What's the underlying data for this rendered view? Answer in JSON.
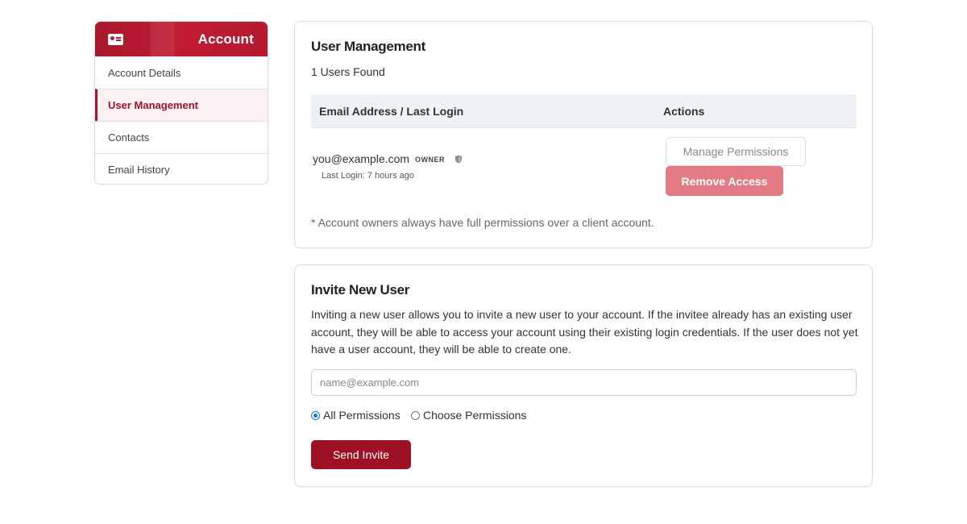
{
  "sidebar": {
    "title": "Account",
    "icon": "id-card-icon",
    "items": [
      {
        "label": "Account Details",
        "active": false
      },
      {
        "label": "User Management",
        "active": true
      },
      {
        "label": "Contacts",
        "active": false
      },
      {
        "label": "Email History",
        "active": false
      }
    ]
  },
  "user_management": {
    "title": "User Management",
    "count_text": "1 Users Found",
    "columns": [
      "Email Address / Last Login",
      "Actions"
    ],
    "rows": [
      {
        "email": "you@example.com",
        "badge": "OWNER",
        "last_login": "Last Login: 7 hours ago",
        "manage_label": "Manage Permissions",
        "remove_label": "Remove Access"
      }
    ],
    "note": "* Account owners always have full permissions over a client account."
  },
  "invite": {
    "title": "Invite New User",
    "description": "Inviting a new user allows you to invite a new user to your account. If the invitee already has an existing user account, they will be able to access your account using their existing login credentials. If the user does not yet have a user account, they will be able to create one.",
    "email_placeholder": "name@example.com",
    "email_value": "",
    "options": [
      {
        "label": "All Permissions",
        "checked": true
      },
      {
        "label": "Choose Permissions",
        "checked": false
      }
    ],
    "submit_label": "Send Invite"
  },
  "colors": {
    "brand": "#a6182b",
    "remove_button": "#e47b84",
    "send_button": "#9e1024",
    "table_header_bg": "#eef1f5"
  }
}
